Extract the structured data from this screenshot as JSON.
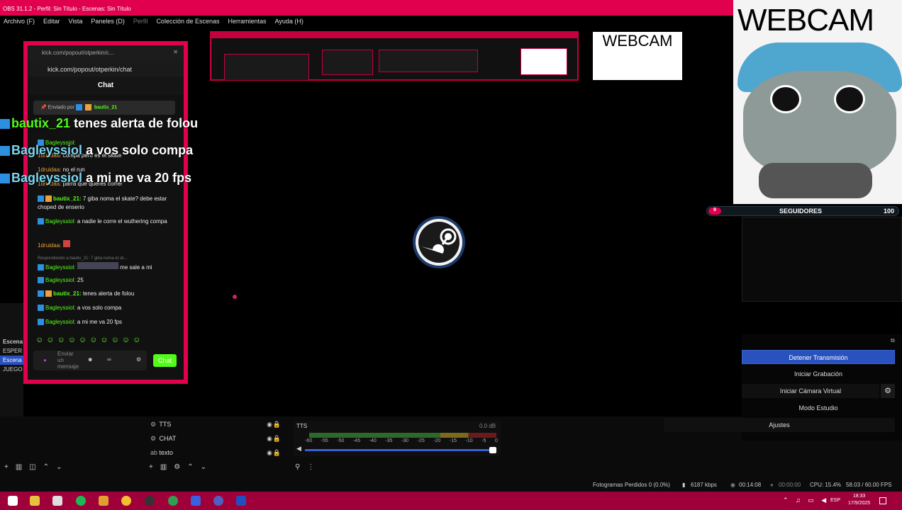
{
  "obs": {
    "title": "OBS 31.1.2 - Perfil: Sin Título - Escenas: Sin Título",
    "menu": [
      "Archivo (F)",
      "Editar",
      "Vista",
      "Paneles (D)",
      "Perfil",
      "Colección de Escenas",
      "Herramientas",
      "Ayuda (H)"
    ]
  },
  "webcam": {
    "label": "WEBCAM"
  },
  "followers": {
    "count": "9",
    "label": "SEGUIDORES",
    "goal": "100"
  },
  "chat": {
    "tab_title": "kick.com/popout/otperkin/c...",
    "url": "kick.com/popout/otperkin/chat",
    "header": "Chat",
    "pinned_prefix": "Enviado por",
    "pinned_user": "bautix_21",
    "messages": [
      {
        "user": "1druidaa:",
        "text": "compa pero es el skate"
      },
      {
        "user": "1druidaa:",
        "text": "no el run"
      },
      {
        "user": "1druidaa:",
        "text": "parra que queres correr"
      },
      {
        "user": "bautix_21:",
        "text": "7 giba noma el skate? debe estar choped de enserio"
      },
      {
        "user": "Bagleyssiol:",
        "text": "a nadie le corre el wuthering compa"
      },
      {
        "user": "1druidaa:",
        "text": ""
      },
      {
        "user": "Respondiendo a bautix_21:",
        "text": "7 giba noma el sk..."
      },
      {
        "user": "Bagleyssiol:",
        "text": "me sale a mi"
      },
      {
        "user": "Bagleyssiol:",
        "text": "25"
      },
      {
        "user": "bautix_21:",
        "text": "tenes alerta de folou"
      },
      {
        "user": "Bagleyssiol:",
        "text": "a vos solo compa"
      },
      {
        "user": "Bagleyssiol:",
        "text": "a mi me va 20 fps"
      }
    ],
    "input_placeholder": "Enviar un mensaje",
    "send_label": "Chat"
  },
  "overlay_chat": [
    {
      "user": "bautix_21",
      "text": "tenes alerta de folou"
    },
    {
      "user": "Bagleyssiol",
      "text": "a vos solo compa"
    },
    {
      "user": "Bagleyssiol",
      "text": "a mi me va 20 fps"
    }
  ],
  "scenes": {
    "header": "Escena",
    "items": [
      "ESPER",
      "Escena",
      "JUEGO"
    ]
  },
  "sources": [
    {
      "name": "TTS",
      "icon": "⚙"
    },
    {
      "name": "CHAT",
      "icon": "⚙"
    },
    {
      "name": "texto",
      "icon": "ab"
    }
  ],
  "mixer": {
    "name": "TTS",
    "db": "0.0 dB",
    "scale": [
      "-60",
      "-55",
      "-50",
      "-45",
      "-40",
      "-35",
      "-30",
      "-25",
      "-20",
      "-15",
      "-10",
      "-5",
      "0"
    ]
  },
  "controls": {
    "stop_stream": "Detener Transmisión",
    "start_recording": "Iniciar Grabación",
    "virtual_camera": "Iniciar Cámara Virtual",
    "studio_mode": "Modo Estudio",
    "settings": "Ajustes"
  },
  "status": {
    "dropped": "Fotogramas Perdidos 0 (0.0%)",
    "bitrate": "6187 kbps",
    "stream_time": "00:14:08",
    "rec_time": "00:00:00",
    "cpu": "CPU: 15.4%",
    "fps": "58.03 / 60.00 FPS"
  },
  "taskbar": {
    "time": "18:33",
    "date": "17/9/2025",
    "lang": "ESP"
  },
  "colors": {
    "accent": "#e0004d",
    "kick_green": "#53fc18",
    "obs_blue": "#2a52be"
  }
}
